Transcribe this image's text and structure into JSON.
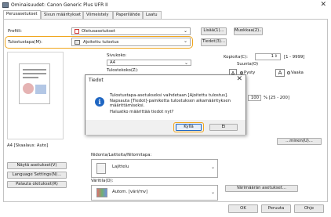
{
  "window": {
    "title": "Ominaisuudet: Canon Generic Plus UFR II"
  },
  "tabs": [
    {
      "label": "Perusasetukset"
    },
    {
      "label": "Sivun määritykset"
    },
    {
      "label": "Viimeistely"
    },
    {
      "label": "Paperilähde"
    },
    {
      "label": "Laatu"
    }
  ],
  "left": {
    "profile_label": "Profiili:",
    "profile_value": "Oletusasetukset",
    "output_label": "Tulostustapa(M):",
    "output_value": "Ajoitettu tulostus",
    "preview_caption": "A4 [Skaalaus: Auto]",
    "show_settings_label": "Näytä asetukset(V)",
    "language_label": "Language Settings(N)...",
    "restore_label": "Palauta oletukset(R)"
  },
  "right": {
    "add_label": "Lisää(1)...",
    "edit_label": "Muokkaa(2)...",
    "details_label": "Tiedot(3)...",
    "page_size_label": "Sivukoko:",
    "page_size_value": "A4",
    "output_size_label": "Tulostekoko(Z):",
    "copies_label": "Kopioita(C):",
    "copies_value": "1",
    "copies_range": "[1 - 9999]",
    "orientation_label": "Suunta(O)",
    "portrait_label": "Pysty",
    "landscape_label": "Vaaka",
    "zoom_value": "100",
    "zoom_range": "% [25 - 200]",
    "layout_button_label": "...minen(U)...",
    "binding_label": "Nidonta/Laitteita/Nitomitapa:",
    "binding_value": "Lajittelu",
    "color_label": "Väritila(D):",
    "color_value": "Autom. [väri/mv]",
    "color_settings_label": "Värimäärän asetukset..."
  },
  "footer": {
    "ok_label": "OK",
    "cancel_label": "Peruuta",
    "help_label": "Ohje"
  },
  "dialog": {
    "title": "Tiedot",
    "message": "Tulostustapa-asetukseksi vaihdetaan [Ajoitettu tulostus]. Napsauta [Tiedot]-painiketta tulostuksen aikamäärityksen määrittämiseksi.",
    "question": "Haluatko määrittää tiedot nyt?",
    "yes_label": "Kyllä",
    "no_label": "Ei",
    "info_glyph": "i",
    "close_glyph": "✕"
  },
  "colors": {
    "highlight": "#f0a51b",
    "accent": "#1f66c2"
  }
}
